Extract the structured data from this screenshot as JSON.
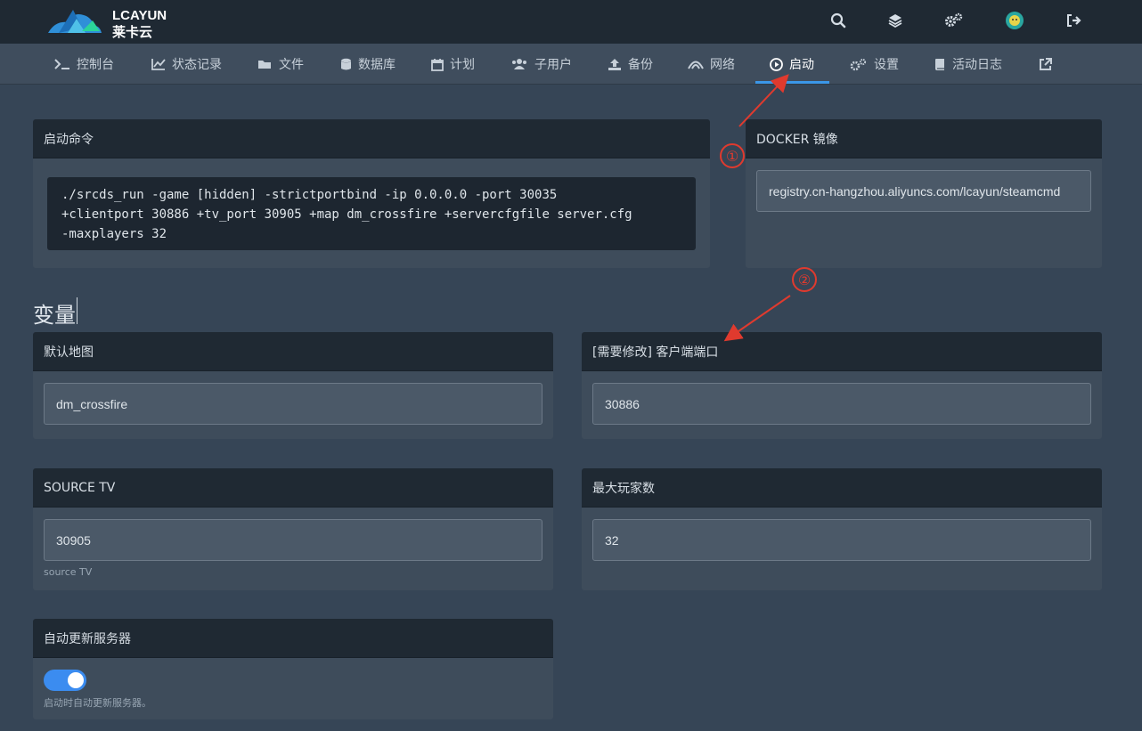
{
  "header": {
    "logo_top": "LCAYUN",
    "logo_bottom": "莱卡云"
  },
  "nav": {
    "items": [
      {
        "label": "控制台",
        "icon": "terminal-icon"
      },
      {
        "label": "状态记录",
        "icon": "chart-icon"
      },
      {
        "label": "文件",
        "icon": "folder-icon"
      },
      {
        "label": "数据库",
        "icon": "database-icon"
      },
      {
        "label": "计划",
        "icon": "calendar-icon"
      },
      {
        "label": "子用户",
        "icon": "users-icon"
      },
      {
        "label": "备份",
        "icon": "upload-icon"
      },
      {
        "label": "网络",
        "icon": "network-icon"
      },
      {
        "label": "启动",
        "icon": "play-icon",
        "active": true
      },
      {
        "label": "设置",
        "icon": "gears-icon"
      },
      {
        "label": "活动日志",
        "icon": "book-icon"
      }
    ]
  },
  "startup": {
    "title": "启动命令",
    "command_lines": [
      "./srcds_run -game [hidden] -strictportbind -ip 0.0.0.0 -port 30035",
      "+clientport 30886 +tv_port 30905 +map dm_crossfire +servercfgfile server.cfg",
      "-maxplayers 32"
    ]
  },
  "docker": {
    "title": "DOCKER 镜像",
    "value": "registry.cn-hangzhou.aliyuncs.com/lcayun/steamcmd"
  },
  "variables": {
    "title": "变量",
    "default_map": {
      "label": "默认地图",
      "value": "dm_crossfire"
    },
    "client_port": {
      "label": "[需要修改] 客户端端口",
      "value": "30886"
    },
    "source_tv": {
      "label": "SOURCE TV",
      "value": "30905",
      "help": "source TV"
    },
    "max_players": {
      "label": "最大玩家数",
      "value": "32"
    },
    "auto_update": {
      "label": "自动更新服务器",
      "help": "启动时自动更新服务器。",
      "enabled": true
    }
  },
  "annotations": {
    "one": "①",
    "two": "②"
  },
  "colors": {
    "accent": "#3b97e8",
    "annotation": "#e03a2e",
    "toggle_on": "#3b8cf0"
  }
}
